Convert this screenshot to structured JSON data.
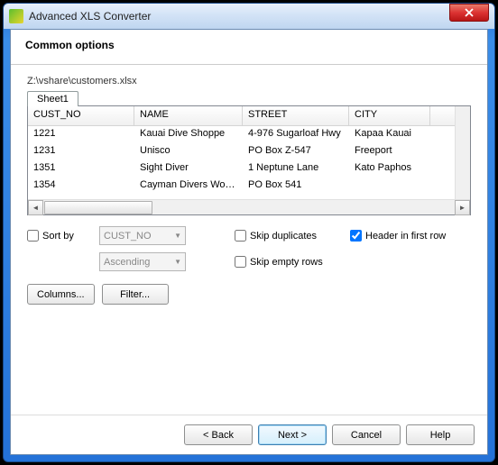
{
  "window": {
    "title": "Advanced XLS Converter"
  },
  "header": {
    "title": "Common options"
  },
  "filepath": "Z:\\vshare\\customers.xlsx",
  "tabs": [
    {
      "label": "Sheet1"
    }
  ],
  "grid": {
    "columns": [
      "CUST_NO",
      "NAME",
      "STREET",
      "CITY"
    ],
    "rows": [
      {
        "c0": "1221",
        "c1": "Kauai Dive Shoppe",
        "c2": "4-976 Sugarloaf Hwy",
        "c3": "Kapaa Kauai"
      },
      {
        "c0": "1231",
        "c1": "Unisco",
        "c2": "PO Box Z-547",
        "c3": "Freeport"
      },
      {
        "c0": "1351",
        "c1": "Sight Diver",
        "c2": "1 Neptune Lane",
        "c3": "Kato Paphos"
      },
      {
        "c0": "1354",
        "c1": "Cayman Divers Worl...",
        "c2": "PO Box 541",
        "c3": ""
      }
    ]
  },
  "options": {
    "sort_by_label": "Sort by",
    "sort_field": "CUST_NO",
    "sort_order": "Ascending",
    "skip_duplicates_label": "Skip duplicates",
    "header_first_row_label": "Header in first row",
    "skip_empty_rows_label": "Skip empty rows",
    "columns_btn": "Columns...",
    "filter_btn": "Filter..."
  },
  "footer": {
    "back": "< Back",
    "next": "Next >",
    "cancel": "Cancel",
    "help": "Help"
  }
}
